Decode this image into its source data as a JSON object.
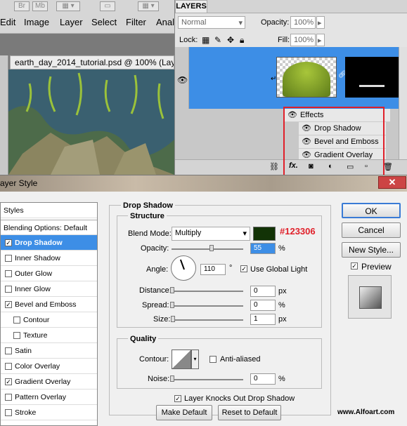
{
  "menubar": {
    "mini_br": "Br",
    "mini_mb": "Mb",
    "items": [
      "Edit",
      "Image",
      "Layer",
      "Select",
      "Filter",
      "Anal"
    ]
  },
  "document": {
    "tab_title": "earth_day_2014_tutorial.psd @ 100% (Laye"
  },
  "layers": {
    "tab": "LAYERS",
    "blend_mode": "Normal",
    "opacity_label": "Opacity:",
    "opacity_value": "100%",
    "lock_label": "Lock:",
    "fill_label": "Fill:",
    "fill_value": "100%",
    "effects_label": "Effects",
    "effects": [
      "Drop Shadow",
      "Bevel and Emboss",
      "Gradient Overlay"
    ],
    "fx": "fx."
  },
  "dialog": {
    "title": "ayer Style",
    "styles_header": "Styles",
    "blending": "Blending Options: Default",
    "items": [
      {
        "label": "Drop Shadow",
        "checked": true,
        "selected": true
      },
      {
        "label": "Inner Shadow",
        "checked": false
      },
      {
        "label": "Outer Glow",
        "checked": false
      },
      {
        "label": "Inner Glow",
        "checked": false
      },
      {
        "label": "Bevel and Emboss",
        "checked": true
      },
      {
        "label": "Contour",
        "checked": false,
        "indent": true
      },
      {
        "label": "Texture",
        "checked": false,
        "indent": true
      },
      {
        "label": "Satin",
        "checked": false
      },
      {
        "label": "Color Overlay",
        "checked": false
      },
      {
        "label": "Gradient Overlay",
        "checked": true
      },
      {
        "label": "Pattern Overlay",
        "checked": false
      },
      {
        "label": "Stroke",
        "checked": false
      }
    ],
    "section_title": "Drop Shadow",
    "structure": "Structure",
    "blend_mode_label": "Blend Mode:",
    "blend_mode": "Multiply",
    "shadow_color": "#123306",
    "color_annotation": "#123306",
    "opacity_label": "Opacity:",
    "opacity_value": "55",
    "opacity_unit": "%",
    "angle_label": "Angle:",
    "angle_value": "110",
    "angle_unit": "°",
    "global_light": "Use Global Light",
    "distance_label": "Distance:",
    "distance_value": "0",
    "spread_label": "Spread:",
    "spread_value": "0",
    "size_label": "Size:",
    "size_value": "1",
    "px": "px",
    "pct": "%",
    "quality": "Quality",
    "contour_label": "Contour:",
    "anti_aliased": "Anti-aliased",
    "noise_label": "Noise:",
    "noise_value": "0",
    "knocks_out": "Layer Knocks Out Drop Shadow",
    "make_default": "Make Default",
    "reset_default": "Reset to Default",
    "ok": "OK",
    "cancel": "Cancel",
    "new_style": "New Style...",
    "preview": "Preview",
    "watermark": "www.Alfoart.com"
  }
}
